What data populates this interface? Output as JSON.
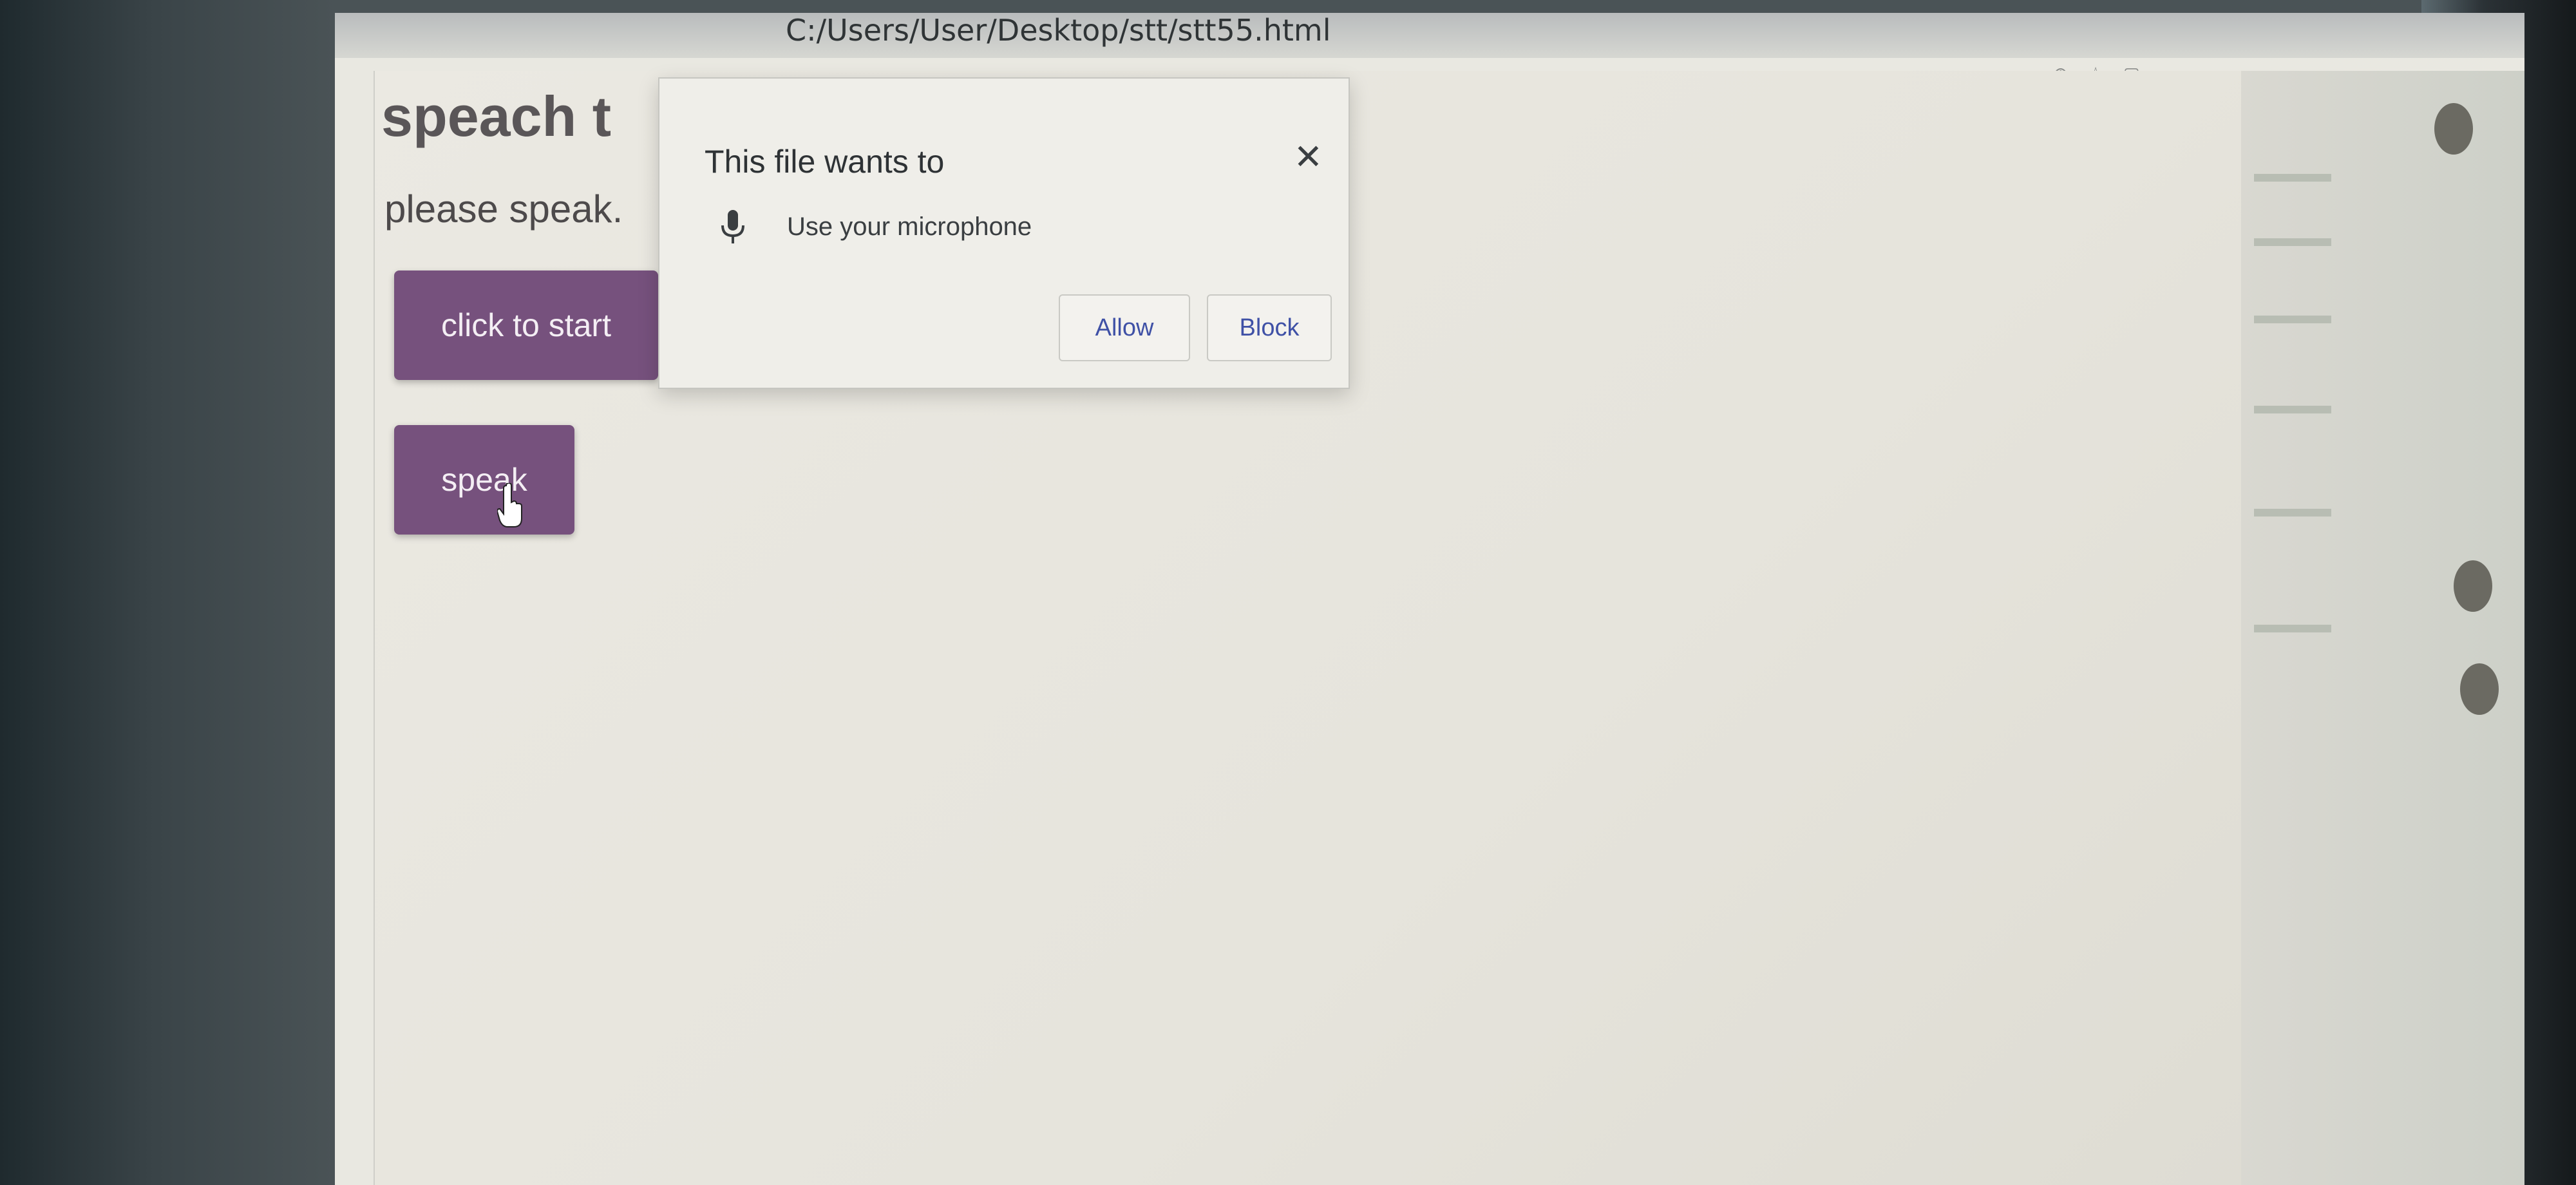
{
  "browser": {
    "url": "C:/Users/User/Desktop/stt/stt55.html"
  },
  "page": {
    "heading": "speach t",
    "instruction": "please speak.",
    "start_button_label": "click to start",
    "speak_button_label": "speak"
  },
  "permission_prompt": {
    "title": "This file wants to",
    "permission_text": "Use your microphone",
    "allow_label": "Allow",
    "block_label": "Block",
    "mic_icon": "microphone-icon",
    "close_icon": "close-icon"
  },
  "colors": {
    "button_bg": "#76517d",
    "link_blue": "#3f51a6",
    "page_bg": "#e9e8e1"
  }
}
